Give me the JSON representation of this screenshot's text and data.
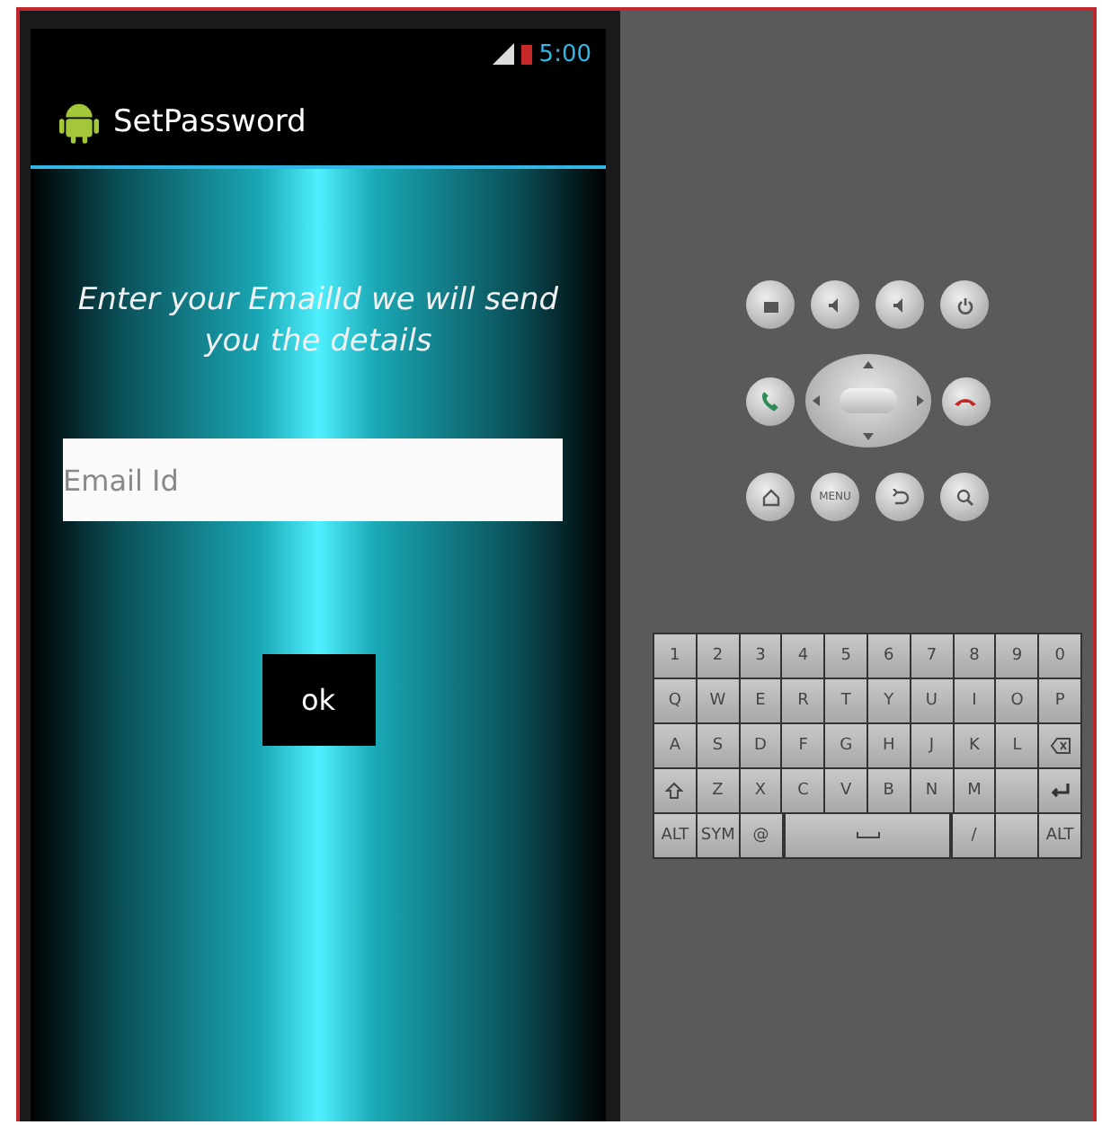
{
  "status_bar": {
    "time": "5:00"
  },
  "action_bar": {
    "title": "SetPassword"
  },
  "form": {
    "prompt": "Enter your EmailId we will send you the details",
    "email_field": {
      "placeholder": "Email Id"
    },
    "ok_button": "ok"
  },
  "emulator_controls": {
    "menu_label": "MENU"
  },
  "keyboard": {
    "rows": [
      [
        {
          "kind": "char",
          "label": "1"
        },
        {
          "kind": "char",
          "label": "2"
        },
        {
          "kind": "char",
          "label": "3"
        },
        {
          "kind": "char",
          "label": "4"
        },
        {
          "kind": "char",
          "label": "5"
        },
        {
          "kind": "char",
          "label": "6"
        },
        {
          "kind": "char",
          "label": "7"
        },
        {
          "kind": "char",
          "label": "8"
        },
        {
          "kind": "char",
          "label": "9"
        },
        {
          "kind": "char",
          "label": "0"
        }
      ],
      [
        {
          "kind": "char",
          "label": "Q"
        },
        {
          "kind": "char",
          "label": "W"
        },
        {
          "kind": "char",
          "label": "E"
        },
        {
          "kind": "char",
          "label": "R"
        },
        {
          "kind": "char",
          "label": "T"
        },
        {
          "kind": "char",
          "label": "Y"
        },
        {
          "kind": "char",
          "label": "U"
        },
        {
          "kind": "char",
          "label": "I"
        },
        {
          "kind": "char",
          "label": "O"
        },
        {
          "kind": "char",
          "label": "P"
        }
      ],
      [
        {
          "kind": "char",
          "label": "A"
        },
        {
          "kind": "char",
          "label": "S"
        },
        {
          "kind": "char",
          "label": "D"
        },
        {
          "kind": "char",
          "label": "F"
        },
        {
          "kind": "char",
          "label": "G"
        },
        {
          "kind": "char",
          "label": "H"
        },
        {
          "kind": "char",
          "label": "J"
        },
        {
          "kind": "char",
          "label": "K"
        },
        {
          "kind": "char",
          "label": "L"
        },
        {
          "kind": "delete"
        }
      ],
      [
        {
          "kind": "shift"
        },
        {
          "kind": "char",
          "label": "Z"
        },
        {
          "kind": "char",
          "label": "X"
        },
        {
          "kind": "char",
          "label": "C"
        },
        {
          "kind": "char",
          "label": "V"
        },
        {
          "kind": "char",
          "label": "B"
        },
        {
          "kind": "char",
          "label": "N"
        },
        {
          "kind": "char",
          "label": "M"
        },
        {
          "kind": "blank"
        },
        {
          "kind": "enter"
        }
      ]
    ],
    "bottom_row": [
      {
        "kind": "char",
        "label": "ALT"
      },
      {
        "kind": "char",
        "label": "SYM"
      },
      {
        "kind": "char",
        "label": "@"
      },
      {
        "kind": "space"
      },
      {
        "kind": "char",
        "label": "/"
      },
      {
        "kind": "blank"
      },
      {
        "kind": "char",
        "label": "ALT"
      }
    ]
  }
}
